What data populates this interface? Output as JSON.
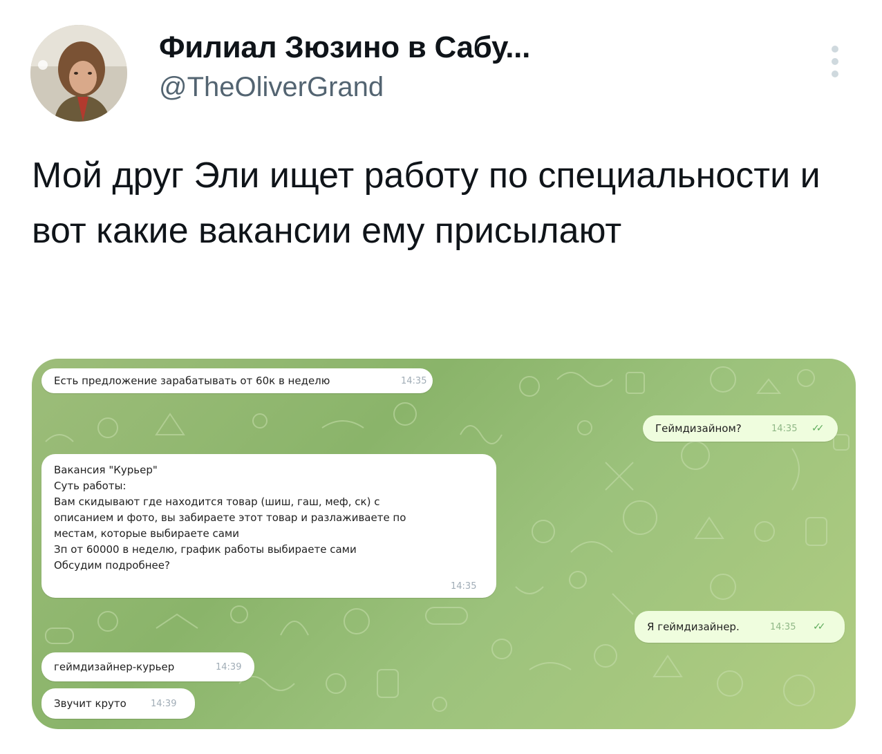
{
  "author": {
    "name": "Филиал Зюзино в Сабу...",
    "handle": "@TheOliverGrand"
  },
  "tweet": {
    "text": "Мой друг Эли ищет работу по специальности и вот какие вакансии ему присылают"
  },
  "chat": {
    "messages": [
      {
        "direction": "in",
        "text": "Есть предложение зарабатывать от 60к в неделю",
        "time": "14:35"
      },
      {
        "direction": "out",
        "text": "Геймдизайном?",
        "time": "14:35",
        "status": "read"
      },
      {
        "direction": "in",
        "lines": [
          "Вакансия \"Курьер\"",
          "Суть работы:",
          "Вам скидывают где находится товар (шиш, гаш, меф, ск) с",
          "описанием и фото, вы забираете этот товар и разлаживаете по",
          "местам, которые выбираете сами",
          "Зп от 60000 в неделю, график работы выбираете сами",
          "Обсудим подробнее?"
        ],
        "time": "14:35"
      },
      {
        "direction": "out",
        "text": "Я геймдизайнер.",
        "time": "14:35",
        "status": "read"
      },
      {
        "direction": "in",
        "text": "геймдизайнер-курьер",
        "time": "14:39"
      },
      {
        "direction": "in",
        "text": "Звучит круто",
        "time": "14:39"
      }
    ],
    "read_mark": "✓✓"
  },
  "colors": {
    "chat_background": "#9dbd7a",
    "incoming_bubble": "#ffffff",
    "outgoing_bubble": "#effdde",
    "handle": "#536471"
  },
  "icons": [
    "avatar-photo",
    "more-dots-icon",
    "read-checkmarks-icon"
  ]
}
